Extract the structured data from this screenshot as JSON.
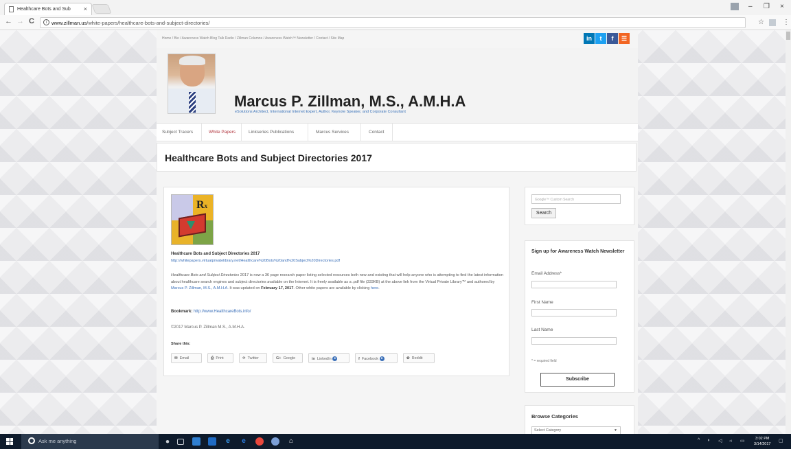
{
  "browser": {
    "tab_title": "Healthcare Bots and Sub",
    "tab_close": "×",
    "url_host": "www.zillman.us",
    "url_path": "/white-papers/healthcare-bots-and-subject-directories/",
    "window_min": "–",
    "window_max": "❐",
    "window_close": "×",
    "back": "←",
    "forward": "→",
    "reload": "C",
    "bookmark_star": "☆",
    "menu": "⋮"
  },
  "site": {
    "top_nav": "Home  /  Bio  /  Awareness Watch Blog Talk Radio  /  Zillman Columns  /  Awareness Watch™ Newsletter  /  Contact  /  Site Map",
    "social": [
      {
        "label": "in",
        "color": "#0077b5"
      },
      {
        "label": "t",
        "color": "#1da1f2"
      },
      {
        "label": "f",
        "color": "#3b5998"
      },
      {
        "label": "☰",
        "color": "#f26522"
      }
    ],
    "name": "Marcus P. Zillman, M.S., A.M.H.A",
    "tagline": "eSolutions Architect, International Internet Expert, Author, Keynote Speaker, and Corporate Consultant",
    "nav": [
      {
        "label": "Subject Tracers",
        "active": false
      },
      {
        "label": "White Papers",
        "active": true
      },
      {
        "label": "Linkseries Publications",
        "active": false
      },
      {
        "label": "Marcus Services",
        "active": false
      },
      {
        "label": "Contact",
        "active": false
      }
    ],
    "page_title": "Healthcare Bots and Subject Directories 2017"
  },
  "article": {
    "title": "Healthcare Bots and Subject Directories 2017",
    "link": "http://whitepapers.virtualprivatelibrary.net/Healthcare%20Bots%20and%20Subject%20Directories.pdf",
    "body_em": "Healthcare Bots and Subject Directories",
    "body_1": " 2017 is now a 36 page research paper listing selected resources both new and existing that will help anyone who is attempting to find the latest information about healthcare search engines and subject directories available on the Internet. It is freely available as a .pdf file (333KB) at the above link from the Virtual Private Library™ and authored by ",
    "author_link": "Marcus P. Zillman, M.S., A.M.H.A.",
    "body_2": " It was updated on ",
    "date": "February 17, 2017",
    "body_3": ". Other white papers are available by clicking ",
    "here": "here",
    "body_4": ".",
    "bookmark_label": "Bookmark:",
    "bookmark_link": "http://www.HealthcareBots.info/",
    "copyright": "©2017 Marcus P. Zillman M.S., A.M.H.A.",
    "share_label": "Share this:",
    "share_buttons": [
      {
        "icon": "✉",
        "label": "Email"
      },
      {
        "icon": "⎙",
        "label": "Print"
      },
      {
        "icon": "✈",
        "label": "Twitter"
      },
      {
        "icon": "G+",
        "label": "Google"
      },
      {
        "icon": "in",
        "label": "LinkedIn"
      },
      {
        "icon": "f",
        "label": "Facebook"
      },
      {
        "icon": "✿",
        "label": "Reddit"
      }
    ]
  },
  "sidebar": {
    "search_placeholder": "Google™ Custom Search",
    "search_button": "Search",
    "newsletter_title": "Sign up for Awareness Watch Newsletter",
    "email_label": "Email Address*",
    "first_name_label": "First Name",
    "last_name_label": "Last Name",
    "required_note": "* = required field",
    "subscribe": "Subscribe",
    "categories_title": "Browse Categories",
    "categories_select": "Select Category"
  },
  "taskbar": {
    "search_text": "Ask me anything",
    "time": "3:02 PM",
    "date": "3/14/2017"
  }
}
